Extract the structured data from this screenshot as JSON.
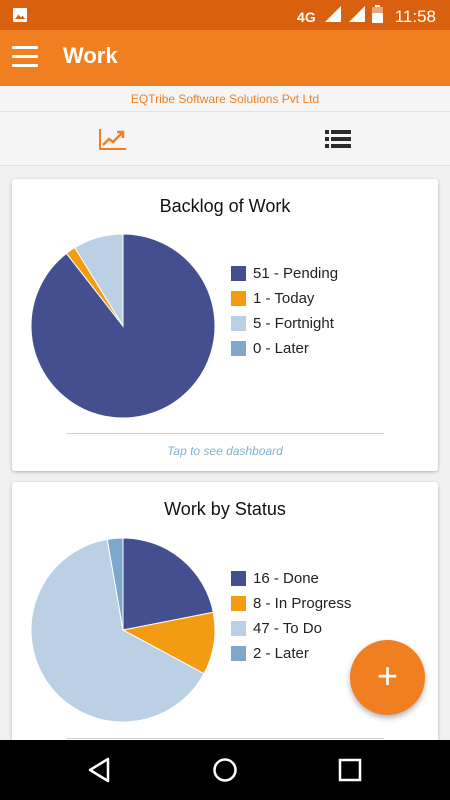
{
  "status_bar": {
    "network": "4G",
    "time": "11:58"
  },
  "app_bar": {
    "title": "Work"
  },
  "company": "EQTribe Software Solutions Pvt Ltd",
  "colors": {
    "primary": "#f07f22",
    "status": "#d9600f",
    "pending": "#434f8f",
    "today": "#f39c12",
    "fortnight": "#bcd0e5",
    "later": "#7fa7cc"
  },
  "tabs": [
    {
      "icon": "trending-up-icon"
    },
    {
      "icon": "list-icon"
    }
  ],
  "cards": [
    {
      "title": "Backlog of Work",
      "footer": "Tap to see dashboard",
      "legend": [
        "51 - Pending",
        "1 - Today",
        "5 - Fortnight",
        "0 - Later"
      ]
    },
    {
      "title": "Work by Status",
      "legend": [
        "16 - Done",
        "8 - In Progress",
        "47 - To Do",
        "2 - Later"
      ]
    }
  ],
  "chart_data": [
    {
      "type": "pie",
      "title": "Backlog of Work",
      "categories": [
        "Pending",
        "Today",
        "Fortnight",
        "Later"
      ],
      "values": [
        51,
        1,
        5,
        0
      ],
      "colors": [
        "#434f8f",
        "#f39c12",
        "#bcd0e5",
        "#7fa7cc"
      ]
    },
    {
      "type": "pie",
      "title": "Work by Status",
      "categories": [
        "Done",
        "In Progress",
        "To Do",
        "Later"
      ],
      "values": [
        16,
        8,
        47,
        2
      ],
      "colors": [
        "#434f8f",
        "#f39c12",
        "#bcd0e5",
        "#7fa7cc"
      ]
    }
  ],
  "fab": {
    "label": "+"
  }
}
